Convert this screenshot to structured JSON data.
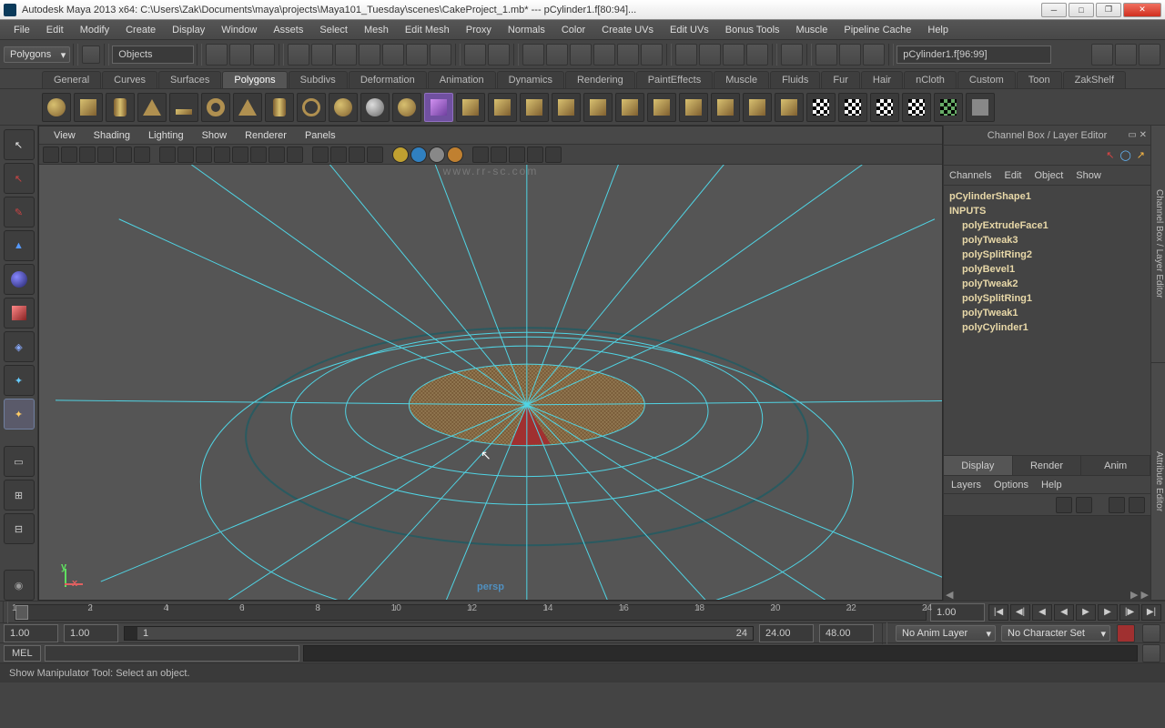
{
  "title": "Autodesk Maya 2013 x64: C:\\Users\\Zak\\Documents\\maya\\projects\\Maya101_Tuesday\\scenes\\CakeProject_1.mb*  ---  pCylinder1.f[80:94]...",
  "watermark": "www.rr-sc.com",
  "menubar": [
    "File",
    "Edit",
    "Modify",
    "Create",
    "Display",
    "Window",
    "Assets",
    "Select",
    "Mesh",
    "Edit Mesh",
    "Proxy",
    "Normals",
    "Color",
    "Create UVs",
    "Edit UVs",
    "Bonus Tools",
    "Muscle",
    "Pipeline Cache",
    "Help"
  ],
  "mode_dropdown": "Polygons",
  "objects_input": "Objects",
  "selection_field": "pCylinder1.f[96:99]",
  "shelf_tabs": [
    "General",
    "Curves",
    "Surfaces",
    "Polygons",
    "Subdivs",
    "Deformation",
    "Animation",
    "Dynamics",
    "Rendering",
    "PaintEffects",
    "Muscle",
    "Fluids",
    "Fur",
    "Hair",
    "nCloth",
    "Custom",
    "Toon",
    "ZakShelf"
  ],
  "active_shelf_tab": "Polygons",
  "view_menu": [
    "View",
    "Shading",
    "Lighting",
    "Show",
    "Renderer",
    "Panels"
  ],
  "camera_label": "persp",
  "rightpanel_title": "Channel Box / Layer Editor",
  "channel_tabs": [
    "Channels",
    "Edit",
    "Object",
    "Show"
  ],
  "channel_items": [
    {
      "label": "pCylinderShape1",
      "sub": false
    },
    {
      "label": "INPUTS",
      "sub": false
    },
    {
      "label": "polyExtrudeFace1",
      "sub": true
    },
    {
      "label": "polyTweak3",
      "sub": true
    },
    {
      "label": "polySplitRing2",
      "sub": true
    },
    {
      "label": "polyBevel1",
      "sub": true
    },
    {
      "label": "polyTweak2",
      "sub": true
    },
    {
      "label": "polySplitRing1",
      "sub": true
    },
    {
      "label": "polyTweak1",
      "sub": true
    },
    {
      "label": "polyCylinder1",
      "sub": true
    }
  ],
  "layer_tabs": [
    "Display",
    "Render",
    "Anim"
  ],
  "layer_menu": [
    "Layers",
    "Options",
    "Help"
  ],
  "side_tabs": [
    "Channel Box / Layer Editor",
    "Attribute Editor"
  ],
  "timeslider": {
    "ticks": [
      "1",
      "2",
      "4",
      "6",
      "8",
      "10",
      "12",
      "14",
      "16",
      "18",
      "20",
      "22",
      "24"
    ],
    "current": "1.00"
  },
  "range": {
    "start": "1.00",
    "anim_start": "1.00",
    "inner_start": "1",
    "inner_end": "24",
    "anim_end": "24.00",
    "end": "48.00"
  },
  "anim_layer_label": "No Anim Layer",
  "char_set_label": "No Character Set",
  "cmd_label": "MEL",
  "helpline": "Show Manipulator Tool: Select an object."
}
